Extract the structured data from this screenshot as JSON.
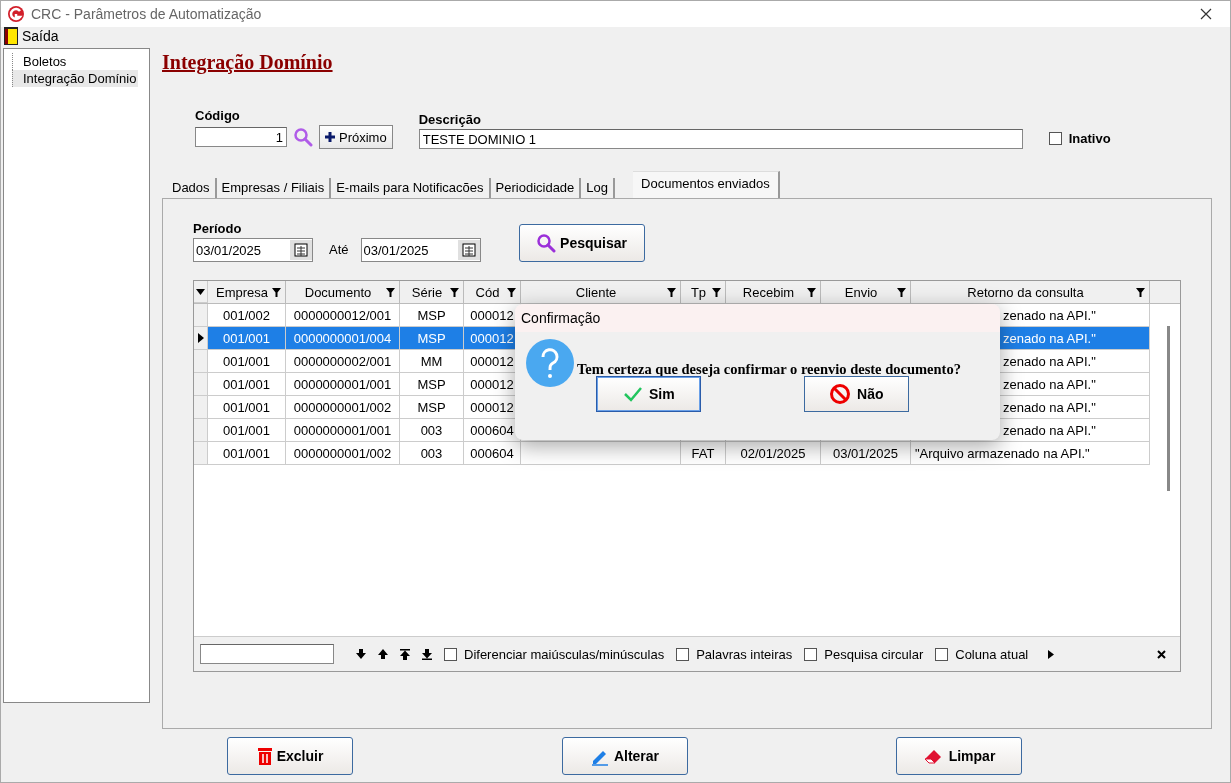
{
  "window": {
    "title": "CRC - Parâmetros de Automatização"
  },
  "menu": [
    {
      "label": "Saída"
    }
  ],
  "tree": [
    {
      "label": "Boletos",
      "selected": false
    },
    {
      "label": "Integração Domínio",
      "selected": true
    }
  ],
  "heading": "Integração Domínio",
  "codigo": {
    "label": "Código",
    "value": "1"
  },
  "next_button": "Próximo",
  "descricao": {
    "label": "Descrição",
    "value": "TESTE DOMINIO 1"
  },
  "inativo": {
    "label": "Inativo",
    "checked": false
  },
  "tabs": [
    {
      "label": "Dados",
      "selected": false
    },
    {
      "label": "Empresas / Filiais",
      "selected": false
    },
    {
      "label": "E-mails para Notificacões",
      "selected": false
    },
    {
      "label": "Periodicidade",
      "selected": false
    },
    {
      "label": "Log",
      "selected": false
    },
    {
      "label": "Documentos enviados",
      "selected": true
    }
  ],
  "periodo": {
    "label": "Período",
    "from": "03/01/2025",
    "until_label": "Até",
    "to": "03/01/2025"
  },
  "search_button": "Pesquisar",
  "table": {
    "columns": [
      "Empresa",
      "Documento",
      "Série",
      "Cód",
      "Cliente",
      "Tp",
      "Recebim",
      "Envio",
      "Retorno da consulta"
    ],
    "rows": [
      {
        "selected": false,
        "covered": true,
        "cells": [
          "001/002",
          "0000000012/001",
          "MSP",
          "000012",
          "",
          "",
          "",
          "",
          "zenado na API.\""
        ]
      },
      {
        "selected": true,
        "covered": true,
        "cells": [
          "001/001",
          "0000000001/004",
          "MSP",
          "000012",
          "",
          "",
          "",
          "",
          "zenado na API.\""
        ]
      },
      {
        "selected": false,
        "covered": true,
        "cells": [
          "001/001",
          "0000000002/001",
          "MM",
          "000012",
          "",
          "",
          "",
          "",
          "zenado na API.\""
        ]
      },
      {
        "selected": false,
        "covered": true,
        "cells": [
          "001/001",
          "0000000001/001",
          "MSP",
          "000012",
          "",
          "",
          "",
          "",
          "zenado na API.\""
        ]
      },
      {
        "selected": false,
        "covered": true,
        "cells": [
          "001/001",
          "0000000001/002",
          "MSP",
          "000012",
          "",
          "",
          "",
          "",
          "zenado na API.\""
        ]
      },
      {
        "selected": false,
        "covered": true,
        "cells": [
          "001/001",
          "0000000001/001",
          "003",
          "000604",
          "",
          "",
          "",
          "",
          "zenado na API.\""
        ]
      },
      {
        "selected": false,
        "covered": false,
        "cells": [
          "001/001",
          "0000000001/002",
          "003",
          "000604",
          "",
          "FAT",
          "02/01/2025",
          "03/01/2025",
          "\"Arquivo armazenado na API.\""
        ]
      }
    ]
  },
  "find_bar": {
    "options": [
      {
        "label": "Diferenciar maiúsculas/minúsculas",
        "checked": false
      },
      {
        "label": "Palavras inteiras",
        "checked": false
      },
      {
        "label": "Pesquisa circular",
        "checked": false
      },
      {
        "label": "Coluna atual",
        "checked": false
      }
    ]
  },
  "dialog": {
    "title": "Confirmação",
    "message": "Tem certeza que deseja confirmar o reenvio deste documento?",
    "buttons": [
      {
        "label": "Sim",
        "kind": "yes"
      },
      {
        "label": "Não",
        "kind": "no"
      }
    ]
  },
  "buttons": [
    {
      "label": "Excluir",
      "kind": "delete"
    },
    {
      "label": "Alterar",
      "kind": "edit"
    },
    {
      "label": "Limpar",
      "kind": "clear"
    }
  ]
}
